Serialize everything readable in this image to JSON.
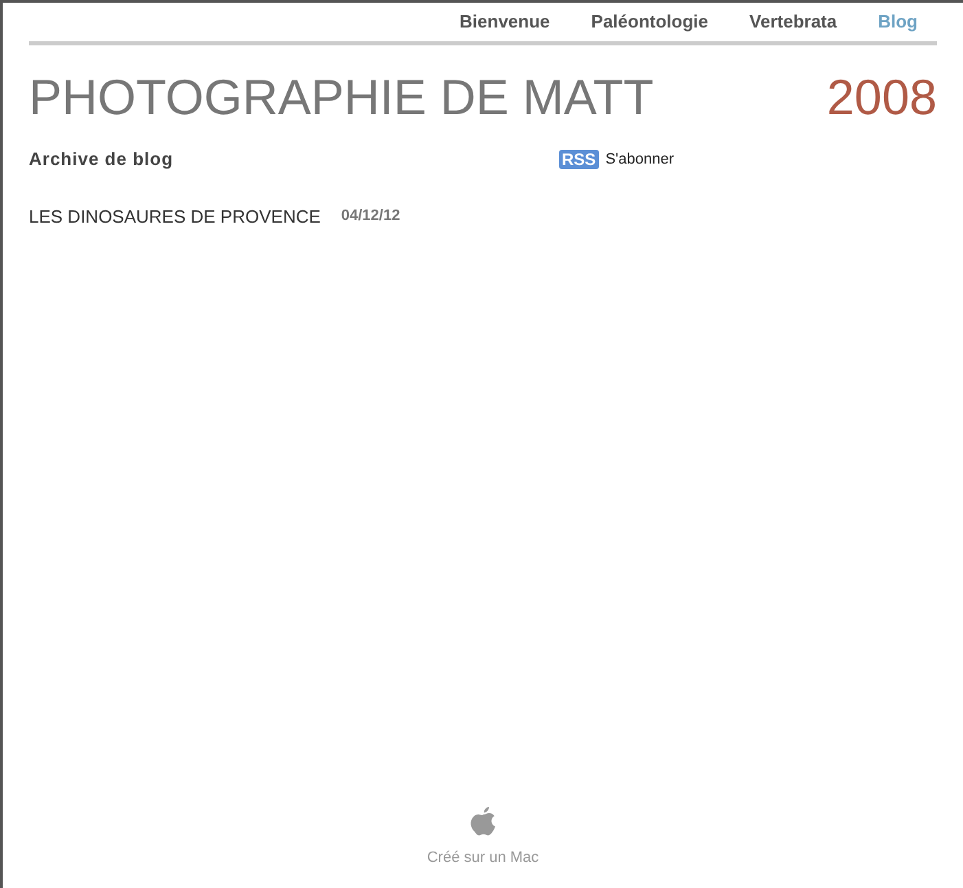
{
  "nav": [
    {
      "label": "Bienvenue",
      "selected": false
    },
    {
      "label": "Paléontologie",
      "selected": false
    },
    {
      "label": "Vertebrata",
      "selected": false
    },
    {
      "label": "Blog",
      "selected": true
    }
  ],
  "header": {
    "title": "PHOTOGRAPHIE DE MATT",
    "year": "2008"
  },
  "archive": {
    "heading": "Archive de blog",
    "rss_badge": "RSS",
    "subscribe": "S'abonner"
  },
  "posts": [
    {
      "title": "LES DINOSAURES DE PROVENCE",
      "date": "04/12/12"
    }
  ],
  "footer": {
    "text": "Créé sur un Mac"
  }
}
